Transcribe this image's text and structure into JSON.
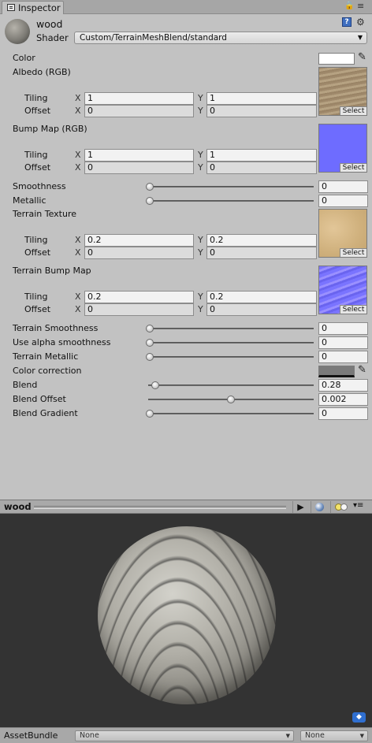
{
  "tab": {
    "label": "Inspector"
  },
  "header": {
    "name": "wood",
    "shader_label": "Shader",
    "shader_value": "Custom/TerrainMeshBlend/standard"
  },
  "props": {
    "color": "Color",
    "albedo": "Albedo (RGB)",
    "bump": "Bump Map (RGB)",
    "smoothness": "Smoothness",
    "metallic": "Metallic",
    "terrain_texture": "Terrain Texture",
    "terrain_bump": "Terrain Bump Map",
    "terrain_smoothness": "Terrain Smoothness",
    "use_alpha": "Use alpha smoothness",
    "terrain_metallic": "Terrain Metallic",
    "color_correction": "Color correction",
    "blend": "Blend",
    "blend_offset": "Blend Offset",
    "blend_gradient": "Blend Gradient",
    "tiling": "Tiling",
    "offset": "Offset",
    "x": "X",
    "y": "Y",
    "select": "Select"
  },
  "values": {
    "albedo_tiling_x": "1",
    "albedo_tiling_y": "1",
    "albedo_offset_x": "0",
    "albedo_offset_y": "0",
    "bump_tiling_x": "1",
    "bump_tiling_y": "1",
    "bump_offset_x": "0",
    "bump_offset_y": "0",
    "smoothness": "0",
    "metallic": "0",
    "terrain_tiling_x": "0.2",
    "terrain_tiling_y": "0.2",
    "terrain_offset_x": "0",
    "terrain_offset_y": "0",
    "terrain_bump_tiling_x": "0.2",
    "terrain_bump_tiling_y": "0.2",
    "terrain_bump_offset_x": "0",
    "terrain_bump_offset_y": "0",
    "terrain_smoothness": "0",
    "use_alpha": "0",
    "terrain_metallic": "0",
    "blend": "0.28",
    "blend_offset": "0.002",
    "blend_gradient": "0"
  },
  "slider_levels": {
    "smoothness": 0.0,
    "metallic": 0.0,
    "terrain_smoothness": 0.0,
    "use_alpha": 0.0,
    "terrain_metallic": 0.0,
    "blend": 0.05,
    "blend_offset": 0.5,
    "blend_gradient": 0.0
  },
  "colors": {
    "color_swatch": "#ffffff",
    "color_correction_swatch": "#7a7a7a",
    "bump_texture": "#6a6aff",
    "albedo_texture": "#a89478",
    "terrain_texture": "#d8bc8a"
  },
  "preview": {
    "title": "wood"
  },
  "footer": {
    "assetbundle_label": "AssetBundle",
    "bundle_value": "None",
    "variant_value": "None"
  }
}
